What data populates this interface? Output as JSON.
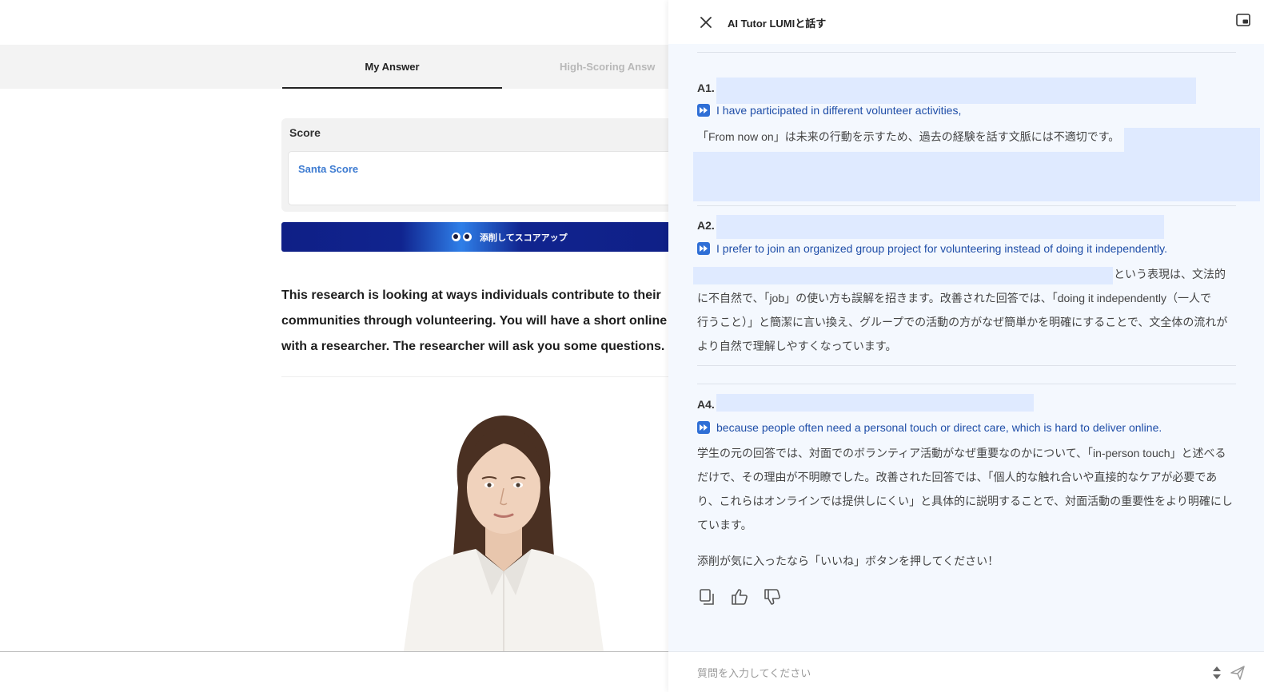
{
  "left": {
    "tabs": {
      "my_answer": "My Answer",
      "high_scoring": "High-Scoring Answ"
    },
    "score": {
      "title": "Score",
      "santa_score": "Santa Score"
    },
    "cta_label": "添削してスコアアップ",
    "passage": [
      "This research is looking at ways individuals contribute to their",
      "communities through volunteering. You will have a short online",
      "with a researcher. The researcher will ask you some questions."
    ]
  },
  "panel": {
    "title": "AI Tutor LUMIと話す",
    "answers": [
      {
        "key": "A1.",
        "improved": "I have participated in different volunteer activities,",
        "explanation_lines": [
          "「From now on」は未来の行動を示すため、過去の経験を話す文脈には不適切です。"
        ]
      },
      {
        "key": "A2.",
        "improved": "I prefer to join an organized group project for volunteering instead of doing it independently.",
        "explanation_lines": [
          "という表現は、文法的",
          "に不自然で、「job」の使い方も誤解を招きます。改善された回答では、「doing it independently（一人で",
          "行うこと）」と簡潔に言い換え、グループでの活動の方がなぜ簡単かを明確にすることで、文全体の流れが",
          "より自然で理解しやすくなっています。"
        ]
      },
      {
        "key": "A4.",
        "improved": "because people often need a personal touch or direct care, which is hard to deliver online.",
        "explanation_lines": [
          "学生の元の回答では、対面でのボランティア活動がなぜ重要なのかについて、「in-person touch」と述べる",
          "だけで、その理由が不明瞭でした。改善された回答では、「個人的な触れ合いや直接的なケアが必要であ",
          "り、これらはオンラインでは提供しにくい」と具体的に説明することで、対面活動の重要性をより明確にし",
          "ています。"
        ]
      }
    ],
    "like_prompt": "添削が気に入ったなら「いいね」ボタンを押してください！",
    "input_placeholder": "質問を入力してください"
  },
  "colors": {
    "accent": "#2f6fd6",
    "improved_text": "#1f4ea8",
    "cta_navy": "#10248f",
    "highlight": "#dfeaff"
  },
  "icons": [
    "close-icon",
    "picture-in-picture-icon",
    "fast-forward-icon",
    "copy-icon",
    "thumbs-up-icon",
    "thumbs-down-icon",
    "send-icon",
    "stepper-icon"
  ]
}
